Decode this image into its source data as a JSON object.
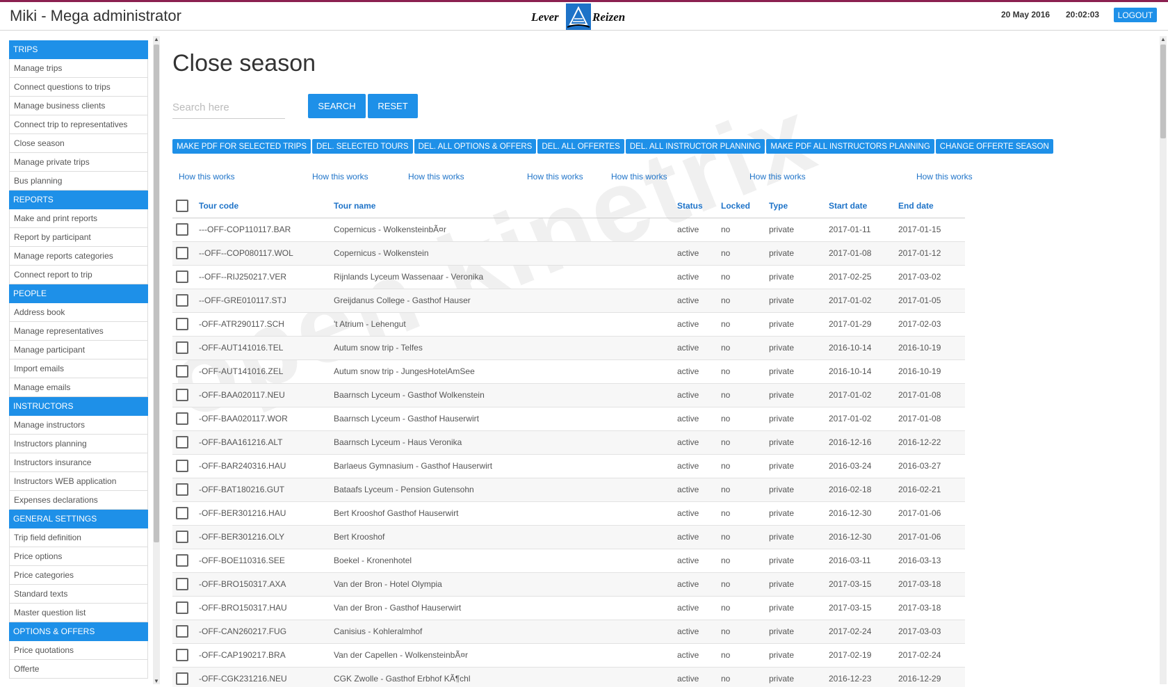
{
  "header": {
    "app_title": "Miki - Mega administrator",
    "logo_left": "Lever",
    "logo_right": "Reizen",
    "date": "20 May 2016",
    "time": "20:02:03",
    "logout_label": "LOGOUT"
  },
  "sidebar": {
    "sections": [
      {
        "title": "TRIPS",
        "items": [
          "Manage trips",
          "Connect questions to trips",
          "Manage business clients",
          "Connect trip to representatives",
          "Close season",
          "Manage private trips",
          "Bus planning"
        ]
      },
      {
        "title": "REPORTS",
        "items": [
          "Make and print reports",
          "Report by participant",
          "Manage reports categories",
          "Connect report to trip"
        ]
      },
      {
        "title": "PEOPLE",
        "items": [
          "Address book",
          "Manage representatives",
          "Manage participant",
          "Import emails",
          "Manage emails"
        ]
      },
      {
        "title": "INSTRUCTORS",
        "items": [
          "Manage instructors",
          "Instructors planning",
          "Instructors insurance",
          "Instructors WEB application",
          "Expenses declarations"
        ]
      },
      {
        "title": "GENERAL SETTINGS",
        "items": [
          "Trip field definition",
          "Price options",
          "Price categories",
          "Standard texts",
          "Master question list"
        ]
      },
      {
        "title": "OPTIONS & OFFERS",
        "items": [
          "Price quotations",
          "Offerte"
        ]
      }
    ]
  },
  "main": {
    "title": "Close season",
    "search_placeholder": "Search here",
    "search_label": "SEARCH",
    "reset_label": "RESET",
    "actions": [
      "MAKE PDF FOR SELECTED TRIPS",
      "DEL. SELECTED TOURS",
      "DEL. ALL OPTIONS & OFFERS",
      "DEL. ALL OFFERTES",
      "DEL. ALL INSTRUCTOR PLANNING",
      "MAKE PDF ALL INSTRUCTORS PLANNING",
      "CHANGE OFFERTE SEASON"
    ],
    "how_label": "How this works",
    "watermark": "open kinetrix"
  },
  "table": {
    "headers": [
      "Tour code",
      "Tour name",
      "Status",
      "Locked",
      "Type",
      "Start date",
      "End date"
    ],
    "rows": [
      [
        "---OFF-COP110117.BAR",
        "Copernicus - WolkensteinbÃ¤r",
        "active",
        "no",
        "private",
        "2017-01-11",
        "2017-01-15"
      ],
      [
        "--OFF--COP080117.WOL",
        "Copernicus - Wolkenstein",
        "active",
        "no",
        "private",
        "2017-01-08",
        "2017-01-12"
      ],
      [
        "--OFF--RIJ250217.VER",
        "Rijnlands Lyceum Wassenaar - Veronika",
        "active",
        "no",
        "private",
        "2017-02-25",
        "2017-03-02"
      ],
      [
        "--OFF-GRE010117.STJ",
        "Greijdanus College - Gasthof Hauser",
        "active",
        "no",
        "private",
        "2017-01-02",
        "2017-01-05"
      ],
      [
        "-OFF-ATR290117.SCH",
        "'t Atrium - Lehengut",
        "active",
        "no",
        "private",
        "2017-01-29",
        "2017-02-03"
      ],
      [
        "-OFF-AUT141016.TEL",
        "Autum snow trip - Telfes",
        "active",
        "no",
        "private",
        "2016-10-14",
        "2016-10-19"
      ],
      [
        "-OFF-AUT141016.ZEL",
        "Autum snow trip - JungesHotelAmSee",
        "active",
        "no",
        "private",
        "2016-10-14",
        "2016-10-19"
      ],
      [
        "-OFF-BAA020117.NEU",
        "Baarnsch Lyceum - Gasthof Wolkenstein",
        "active",
        "no",
        "private",
        "2017-01-02",
        "2017-01-08"
      ],
      [
        "-OFF-BAA020117.WOR",
        "Baarnsch Lyceum - Gasthof Hauserwirt",
        "active",
        "no",
        "private",
        "2017-01-02",
        "2017-01-08"
      ],
      [
        "-OFF-BAA161216.ALT",
        "Baarnsch Lyceum - Haus Veronika",
        "active",
        "no",
        "private",
        "2016-12-16",
        "2016-12-22"
      ],
      [
        "-OFF-BAR240316.HAU",
        "Barlaeus Gymnasium - Gasthof Hauserwirt",
        "active",
        "no",
        "private",
        "2016-03-24",
        "2016-03-27"
      ],
      [
        "-OFF-BAT180216.GUT",
        "Bataafs Lyceum - Pension Gutensohn",
        "active",
        "no",
        "private",
        "2016-02-18",
        "2016-02-21"
      ],
      [
        "-OFF-BER301216.HAU",
        "Bert Krooshof Gasthof Hauserwirt",
        "active",
        "no",
        "private",
        "2016-12-30",
        "2017-01-06"
      ],
      [
        "-OFF-BER301216.OLY",
        "Bert Krooshof",
        "active",
        "no",
        "private",
        "2016-12-30",
        "2017-01-06"
      ],
      [
        "-OFF-BOE110316.SEE",
        "Boekel - Kronenhotel",
        "active",
        "no",
        "private",
        "2016-03-11",
        "2016-03-13"
      ],
      [
        "-OFF-BRO150317.AXA",
        "Van der Bron - Hotel Olympia",
        "active",
        "no",
        "private",
        "2017-03-15",
        "2017-03-18"
      ],
      [
        "-OFF-BRO150317.HAU",
        "Van der Bron - Gasthof Hauserwirt",
        "active",
        "no",
        "private",
        "2017-03-15",
        "2017-03-18"
      ],
      [
        "-OFF-CAN260217.FUG",
        "Canisius - Kohleralmhof",
        "active",
        "no",
        "private",
        "2017-02-24",
        "2017-03-03"
      ],
      [
        "-OFF-CAP190217.BRA",
        "Van der Capellen - WolkensteinbÃ¤r",
        "active",
        "no",
        "private",
        "2017-02-19",
        "2017-02-24"
      ],
      [
        "-OFF-CGK231216.NEU",
        "CGK Zwolle - Gasthof Erbhof KÃ¶chl",
        "active",
        "no",
        "private",
        "2016-12-23",
        "2016-12-29"
      ]
    ]
  }
}
